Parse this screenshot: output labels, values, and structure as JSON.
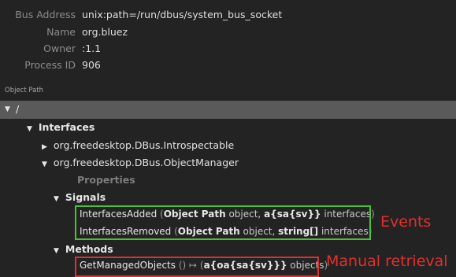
{
  "bus_info": [
    {
      "label": "Bus Address",
      "value": "unix:path=/run/dbus/system_bus_socket"
    },
    {
      "label": "Name",
      "value": "org.bluez"
    },
    {
      "label": "Owner",
      "value": ":1.1"
    },
    {
      "label": "Process ID",
      "value": "906"
    }
  ],
  "tree": {
    "section_label": "Object Path",
    "root": "/",
    "interfaces_label": "Interfaces",
    "iface_introspectable": "org.freedesktop.DBus.Introspectable",
    "iface_object_manager": "org.freedesktop.DBus.ObjectManager",
    "properties_label": "Properties",
    "signals_label": "Signals",
    "signals": [
      {
        "name": "InterfacesAdded",
        "open": " (",
        "t1": "Object Path",
        "p1": " object, ",
        "t2": "a{sa{sv}}",
        "p2": " interfaces",
        "close": ")"
      },
      {
        "name": "InterfacesRemoved",
        "open": " (",
        "t1": "Object Path",
        "p1": " object, ",
        "t2": "string[]",
        "p2": " interfaces",
        "close": ")"
      }
    ],
    "methods_label": "Methods",
    "methods": [
      {
        "name": "GetManagedObjects",
        "args": " () ",
        "arrow": "↦",
        "open": " (",
        "t1": "a{oa{sa{sv}}}",
        "p1": " objects",
        "close": ")"
      }
    ]
  },
  "annotations": {
    "events": "Events",
    "manual_retrieval": "Manual retrieval",
    "events_color": "#4fbe3c",
    "manual_color": "#e0302c"
  }
}
